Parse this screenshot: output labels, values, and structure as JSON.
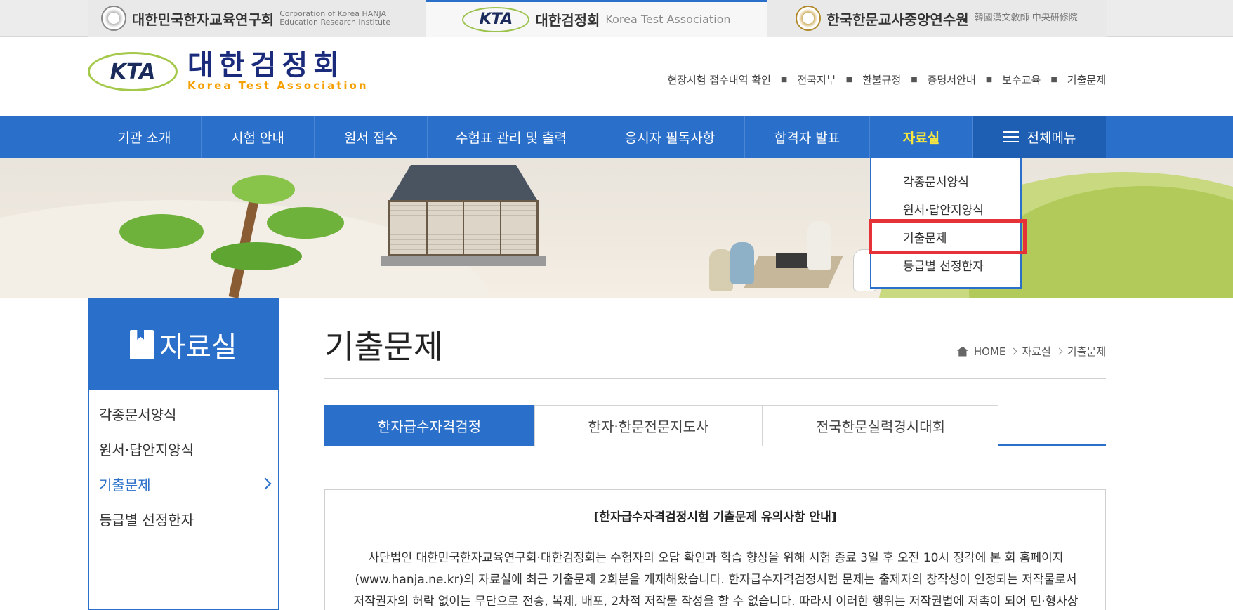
{
  "topbar": {
    "org1": {
      "title": "대한민국한자교육연구회",
      "subtitle": "Corporation of Korea HANJA Education Research Institute"
    },
    "org2": {
      "logo": "KTA",
      "title": "대한검정회",
      "subtitle": "Korea Test Association"
    },
    "org3": {
      "title": "한국한문교사중앙연수원",
      "subtitle": "韓國漢文敎師 中央研修院"
    }
  },
  "header": {
    "logo_mark": "KTA",
    "logo_title": "대한검정회",
    "logo_sub": "Korea Test Association",
    "util_links": [
      "현장시험 접수내역 확인",
      "전국지부",
      "환불규정",
      "증명서안내",
      "보수교육",
      "기출문제"
    ]
  },
  "gnb": {
    "items": [
      "기관 소개",
      "시험 안내",
      "원서 접수",
      "수험표 관리 및 출력",
      "응시자 필독사항",
      "합격자 발표",
      "자료실"
    ],
    "all_menu": "전체메뉴"
  },
  "dropdown": {
    "items": [
      "각종문서양식",
      "원서·답안지양식",
      "기출문제",
      "등급별 선정한자"
    ]
  },
  "sidebar": {
    "title": "자료실",
    "items": [
      "각종문서양식",
      "원서·답안지양식",
      "기출문제",
      "등급별 선정한자"
    ]
  },
  "content": {
    "page_title": "기출문제",
    "breadcrumb": [
      "HOME",
      "자료실",
      "기출문제"
    ],
    "tabs": [
      "한자급수자격검정",
      "한자·한문전문지도사",
      "전국한문실력경시대회"
    ],
    "notice_title": "[한자급수자격검정시험 기출문제 유의사항 안내]",
    "notice_lines": [
      "사단법인 대한민국한자교육연구회·대한검정회는 수험자의 오답 확인과 학습 향상을 위해 시험 종료 3일 후 오전 10시 정각에 본 회 홈페이지",
      "(www.hanja.ne.kr)의 자료실에 최근 기출문제 2회분을 게재해왔습니다. 한자급수자격검정시험 문제는 출제자의 창작성이 인정되는 저작물로서",
      "저작권자의 허락 없이는 무단으로 전송, 복제, 배포, 2차적 저작물 작성을 할 수 없습니다. 따라서 이러한 행위는 저작권법에 저촉이 되어 민·형사상"
    ]
  },
  "colors": {
    "primary": "#2a6fc9",
    "active_gnb": "#f7e640",
    "highlight": "#e53238"
  }
}
